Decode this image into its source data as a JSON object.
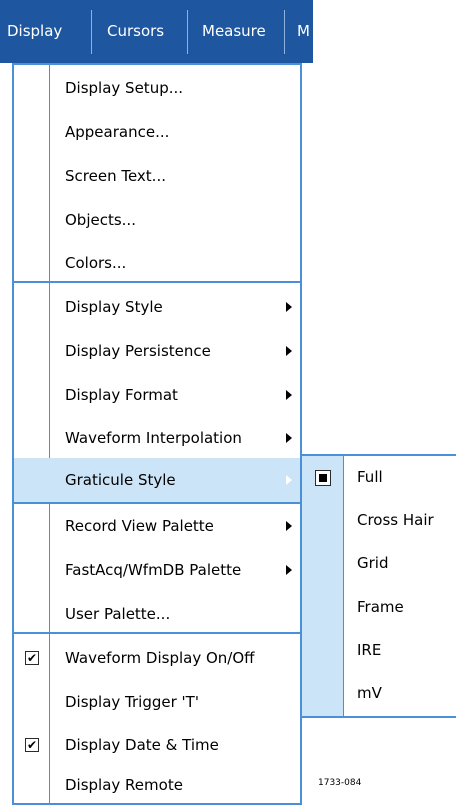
{
  "menubar": {
    "items": [
      {
        "label": "Display"
      },
      {
        "label": "Cursors"
      },
      {
        "label": "Measure"
      },
      {
        "label": "M"
      }
    ]
  },
  "display_menu": {
    "items": [
      {
        "label": "Display Setup..."
      },
      {
        "label": "Appearance..."
      },
      {
        "label": "Screen Text..."
      },
      {
        "label": "Objects..."
      },
      {
        "label": "Colors..."
      },
      {
        "label": "Display Style",
        "submenu": true
      },
      {
        "label": "Display Persistence",
        "submenu": true
      },
      {
        "label": "Display Format",
        "submenu": true
      },
      {
        "label": "Waveform Interpolation",
        "submenu": true
      },
      {
        "label": "Graticule Style",
        "submenu": true,
        "highlighted": true
      },
      {
        "label": "Record View Palette",
        "submenu": true
      },
      {
        "label": "FastAcq/WfmDB Palette",
        "submenu": true
      },
      {
        "label": "User Palette..."
      },
      {
        "label": "Waveform Display On/Off",
        "checked": true
      },
      {
        "label": "Display Trigger 'T'"
      },
      {
        "label": "Display Date & Time",
        "checked": true
      },
      {
        "label": "Display Remote"
      }
    ]
  },
  "graticule_submenu": {
    "items": [
      {
        "label": "Full",
        "selected": true
      },
      {
        "label": "Cross Hair"
      },
      {
        "label": "Grid"
      },
      {
        "label": "Frame"
      },
      {
        "label": "IRE"
      },
      {
        "label": "mV"
      }
    ]
  },
  "check_glyph": "✔",
  "figure_id": "1733-084",
  "colors": {
    "menubar_bg": "#1e56a0",
    "menu_border": "#4a90d9",
    "highlight_bg": "#cce4f7"
  }
}
